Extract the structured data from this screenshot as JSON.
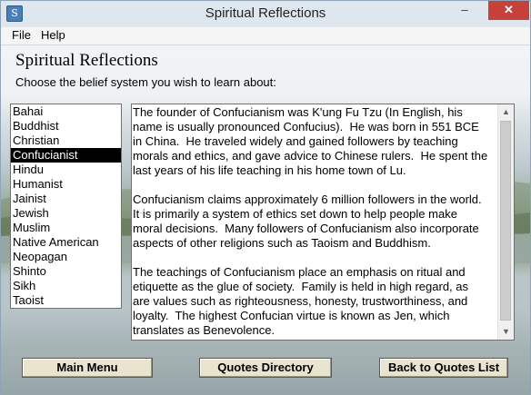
{
  "window": {
    "title": "Spiritual Reflections"
  },
  "titlebar": {
    "minimize": "–",
    "maximize": "□",
    "close": "✕",
    "app_icon": "S"
  },
  "menu": {
    "file": "File",
    "help": "Help"
  },
  "main": {
    "heading": "Spiritual Reflections",
    "prompt": "Choose the belief system you wish to learn about:",
    "beliefs": [
      {
        "label": "Bahai"
      },
      {
        "label": "Buddhist"
      },
      {
        "label": "Christian"
      },
      {
        "label": "Confucianist"
      },
      {
        "label": "Hindu"
      },
      {
        "label": "Humanist"
      },
      {
        "label": "Jainist"
      },
      {
        "label": "Jewish"
      },
      {
        "label": "Muslim"
      },
      {
        "label": "Native American"
      },
      {
        "label": "Neopagan"
      },
      {
        "label": "Shinto"
      },
      {
        "label": "Sikh"
      },
      {
        "label": "Taoist"
      }
    ],
    "selected_belief": "Confucianist",
    "description": [
      "The founder of Confucianism was K'ung Fu Tzu (In English, his\nname is usually pronounced Confucius).  He was born in 551 BCE\nin China.  He traveled widely and gained followers by teaching\nmorals and ethics, and gave advice to Chinese rulers.  He spent the\nlast years of his life teaching in his home town of Lu.",
      "Confucianism claims approximately 6 million followers in the world.\nIt is primarily a system of ethics set down to help people make\nmoral decisions.  Many followers of Confucianism also incorporate\naspects of other religions such as Taoism and Buddhism.",
      "The teachings of Confucianism place an emphasis on ritual and\netiquette as the glue of society.  Family is held in high regard, as\nare values such as righteousness, honesty, trustworthiness, and\nloyalty.  The highest Confucian virtue is known as Jen, which\ntranslates as Benevolence."
    ],
    "scroll_up": "▲",
    "scroll_down": "▼"
  },
  "buttons": {
    "main_menu": "Main Menu",
    "quotes_directory": "Quotes Directory",
    "back_to_quotes": "Back to Quotes List"
  },
  "colors": {
    "selection": "#000000",
    "button_face": "#e9e4cf",
    "close_button": "#c7413b"
  }
}
